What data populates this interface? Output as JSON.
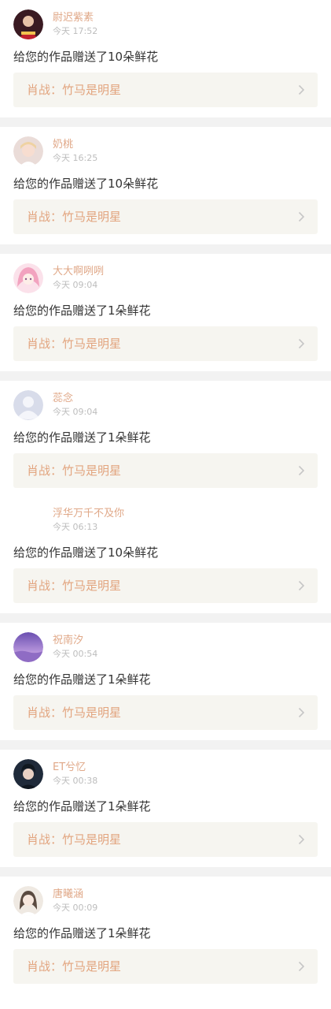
{
  "colors": {
    "username": "#e0a888",
    "time": "#bdbdbd",
    "message": "#333333",
    "link_text": "#e2a47e",
    "link_bg": "#f6f5f0",
    "separator": "#f2f2f2"
  },
  "notifications": [
    {
      "avatar_icon": "avatar-red-costume",
      "username": "尉迟紫素",
      "time": "今天 17:52",
      "message": "给您的作品赠送了10朵鲜花",
      "link_label": "肖战：竹马是明星",
      "chevron_icon": "chevron-right-icon"
    },
    {
      "avatar_icon": "avatar-blonde-girl",
      "username": "奶桃",
      "time": "今天 16:25",
      "message": "给您的作品赠送了10朵鲜花",
      "link_label": "肖战：竹马是明星",
      "chevron_icon": "chevron-right-icon"
    },
    {
      "avatar_icon": "avatar-pink-hair-anime",
      "username": "大大啊咧咧",
      "time": "今天 09:04",
      "message": "给您的作品赠送了1朵鲜花",
      "link_label": "肖战：竹马是明星",
      "chevron_icon": "chevron-right-icon"
    },
    {
      "avatar_icon": "avatar-default-silhouette",
      "username": "蕊念",
      "time": "今天 09:04",
      "message": "给您的作品赠送了1朵鲜花",
      "link_label": "肖战：竹马是明星",
      "chevron_icon": "chevron-right-icon"
    },
    {
      "avatar_icon": "avatar-blank",
      "username": "浮华万千不及你",
      "time": "今天 06:13",
      "message": "给您的作品赠送了10朵鲜花",
      "link_label": "肖战：竹马是明星",
      "chevron_icon": "chevron-right-icon"
    },
    {
      "avatar_icon": "avatar-purple-sky",
      "username": "祝南汐",
      "time": "今天 00:54",
      "message": "给您的作品赠送了1朵鲜花",
      "link_label": "肖战：竹马是明星",
      "chevron_icon": "chevron-right-icon"
    },
    {
      "avatar_icon": "avatar-dark-portrait",
      "username": "ET兮忆",
      "time": "今天 00:38",
      "message": "给您的作品赠送了1朵鲜花",
      "link_label": "肖战：竹马是明星",
      "chevron_icon": "chevron-right-icon"
    },
    {
      "avatar_icon": "avatar-light-portrait",
      "username": "唐曦涵",
      "time": "今天 00:09",
      "message": "给您的作品赠送了1朵鲜花",
      "link_label": "肖战：竹马是明星",
      "chevron_icon": "chevron-right-icon"
    }
  ]
}
